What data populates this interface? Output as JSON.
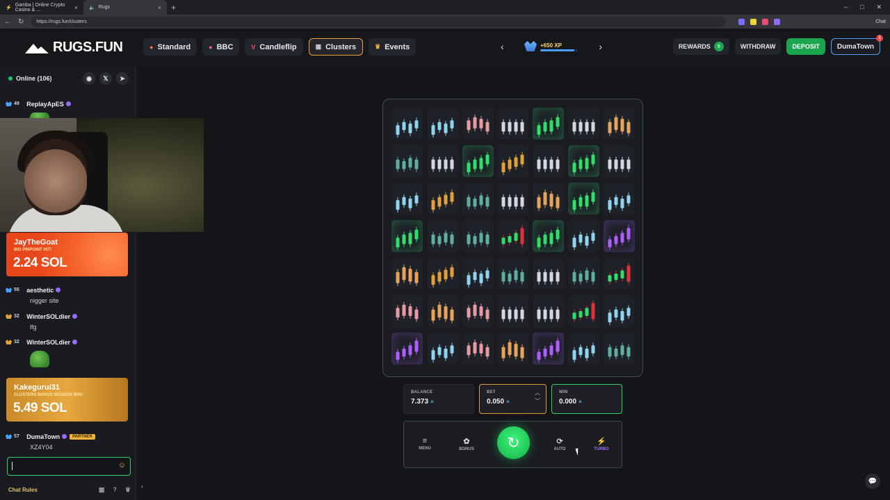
{
  "browser": {
    "tabs": [
      {
        "label": "Gamba | Online Crypto Casino & ...",
        "active": false
      },
      {
        "label": "Rugs",
        "active": true
      }
    ],
    "url": "https://rugs.fun/clusters"
  },
  "header": {
    "logo": "RUGS.FUN",
    "nav": [
      {
        "label": "Standard",
        "icon": "fire-icon",
        "active": false
      },
      {
        "label": "BBC",
        "icon": "pig-icon",
        "active": false
      },
      {
        "label": "Candleflip",
        "icon": "v-icon",
        "active": false
      },
      {
        "label": "Clusters",
        "icon": "grid-icon",
        "active": true
      },
      {
        "label": "Events",
        "icon": "trophy-icon",
        "active": false
      }
    ],
    "xp": {
      "label": "+650 XP",
      "progress": 0.9
    },
    "rewards": {
      "label": "REWARDS",
      "count": "5"
    },
    "withdraw": "WITHDRAW",
    "deposit": "DEPOSIT",
    "user": "DumaTown",
    "notif": "1"
  },
  "sidebar": {
    "online": "Online (106)",
    "messages": [
      {
        "level": "49",
        "user": "ReplayApES",
        "text": ""
      },
      {
        "level": "55",
        "user": "aesthetic",
        "text": "nigger site"
      },
      {
        "level": "32",
        "user": "WinterSOLdier",
        "text": "lfg"
      },
      {
        "level": "32",
        "user": "WinterSOLdier",
        "text": ""
      },
      {
        "level": "57",
        "user": "DumaTown",
        "text": "XZ4Y04",
        "badge": "PARTNER"
      }
    ],
    "banners": [
      {
        "name": "JayTheGoat",
        "sub": "BIG PINPOINT HIT!",
        "amount": "2.24 SOL"
      },
      {
        "name": "Kakeguruí31",
        "sub": "CLUSTERS BONUS SESSION WIN!",
        "amount": "5.49 SOL"
      }
    ],
    "chat_rules": "Chat Rules"
  },
  "game": {
    "grid": [
      [
        "blue",
        "blue",
        "pink",
        "white",
        "green",
        "white",
        "orange"
      ],
      [
        "teal",
        "white",
        "green",
        "gold",
        "white",
        "green",
        "white"
      ],
      [
        "blue",
        "gold",
        "teal",
        "white",
        "orange",
        "green",
        "blue"
      ],
      [
        "green",
        "teal",
        "teal",
        "red",
        "green",
        "blue",
        "purple"
      ],
      [
        "orange",
        "gold",
        "blue",
        "teal",
        "white",
        "teal",
        "red"
      ],
      [
        "pink",
        "orange",
        "pink",
        "white",
        "white",
        "red",
        "blue"
      ],
      [
        "purple",
        "blue",
        "pink",
        "orange",
        "purple",
        "blue",
        "teal"
      ]
    ],
    "balance": {
      "label": "BALANCE",
      "value": "7.373"
    },
    "bet": {
      "label": "BET",
      "value": "0.050"
    },
    "win": {
      "label": "WIN",
      "value": "0.000"
    },
    "controls": {
      "menu": "MENU",
      "bonus": "BONUS",
      "auto": "AUTO",
      "turbo": "TURBO"
    }
  },
  "colors": {
    "blue": "#8fd3ee",
    "pink": "#e89aa2",
    "white": "#d4d8de",
    "green": "#2ee06a",
    "orange": "#e6a45a",
    "teal": "#5fae9e",
    "gold": "#e0a13a",
    "red": "#e0303c",
    "purple": "#b05cff"
  }
}
